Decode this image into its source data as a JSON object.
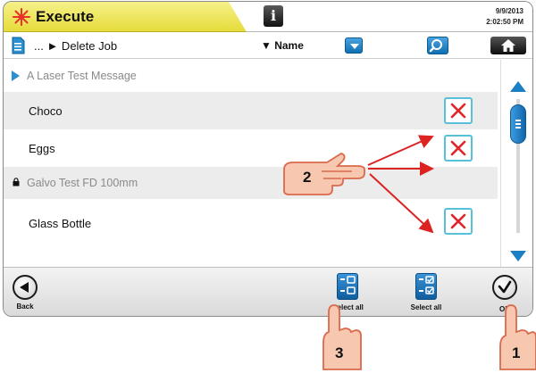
{
  "header": {
    "title": "Execute",
    "info_label": "i",
    "date": "9/9/2013",
    "time": "2:02:50 PM",
    "accent_color": "#e8df3e"
  },
  "toolbar": {
    "breadcrumb": "... ► Delete Job",
    "sort_label": "▼ Name",
    "icons": [
      "document-icon",
      "dropdown-arrow-icon",
      "search-icon",
      "home-icon"
    ]
  },
  "list": {
    "items": [
      {
        "label": "A Laser Test Message",
        "type": "folder"
      },
      {
        "label": "Choco",
        "type": "job",
        "deletable": true
      },
      {
        "label": "Eggs",
        "type": "job",
        "deletable": true
      },
      {
        "label": "Galvo Test FD 100mm",
        "type": "locked"
      },
      {
        "label": "Glass Bottle",
        "type": "job",
        "deletable": true
      }
    ]
  },
  "footer": {
    "back_label": "Back",
    "deselect_all_label": "select all",
    "select_all_label": "Select all",
    "ok_label": "OK"
  },
  "annotations": {
    "callout_1": "1",
    "callout_2": "2",
    "callout_3": "3",
    "arrow_color": "#dd2222",
    "hand_fill": "#f7c7b0"
  }
}
